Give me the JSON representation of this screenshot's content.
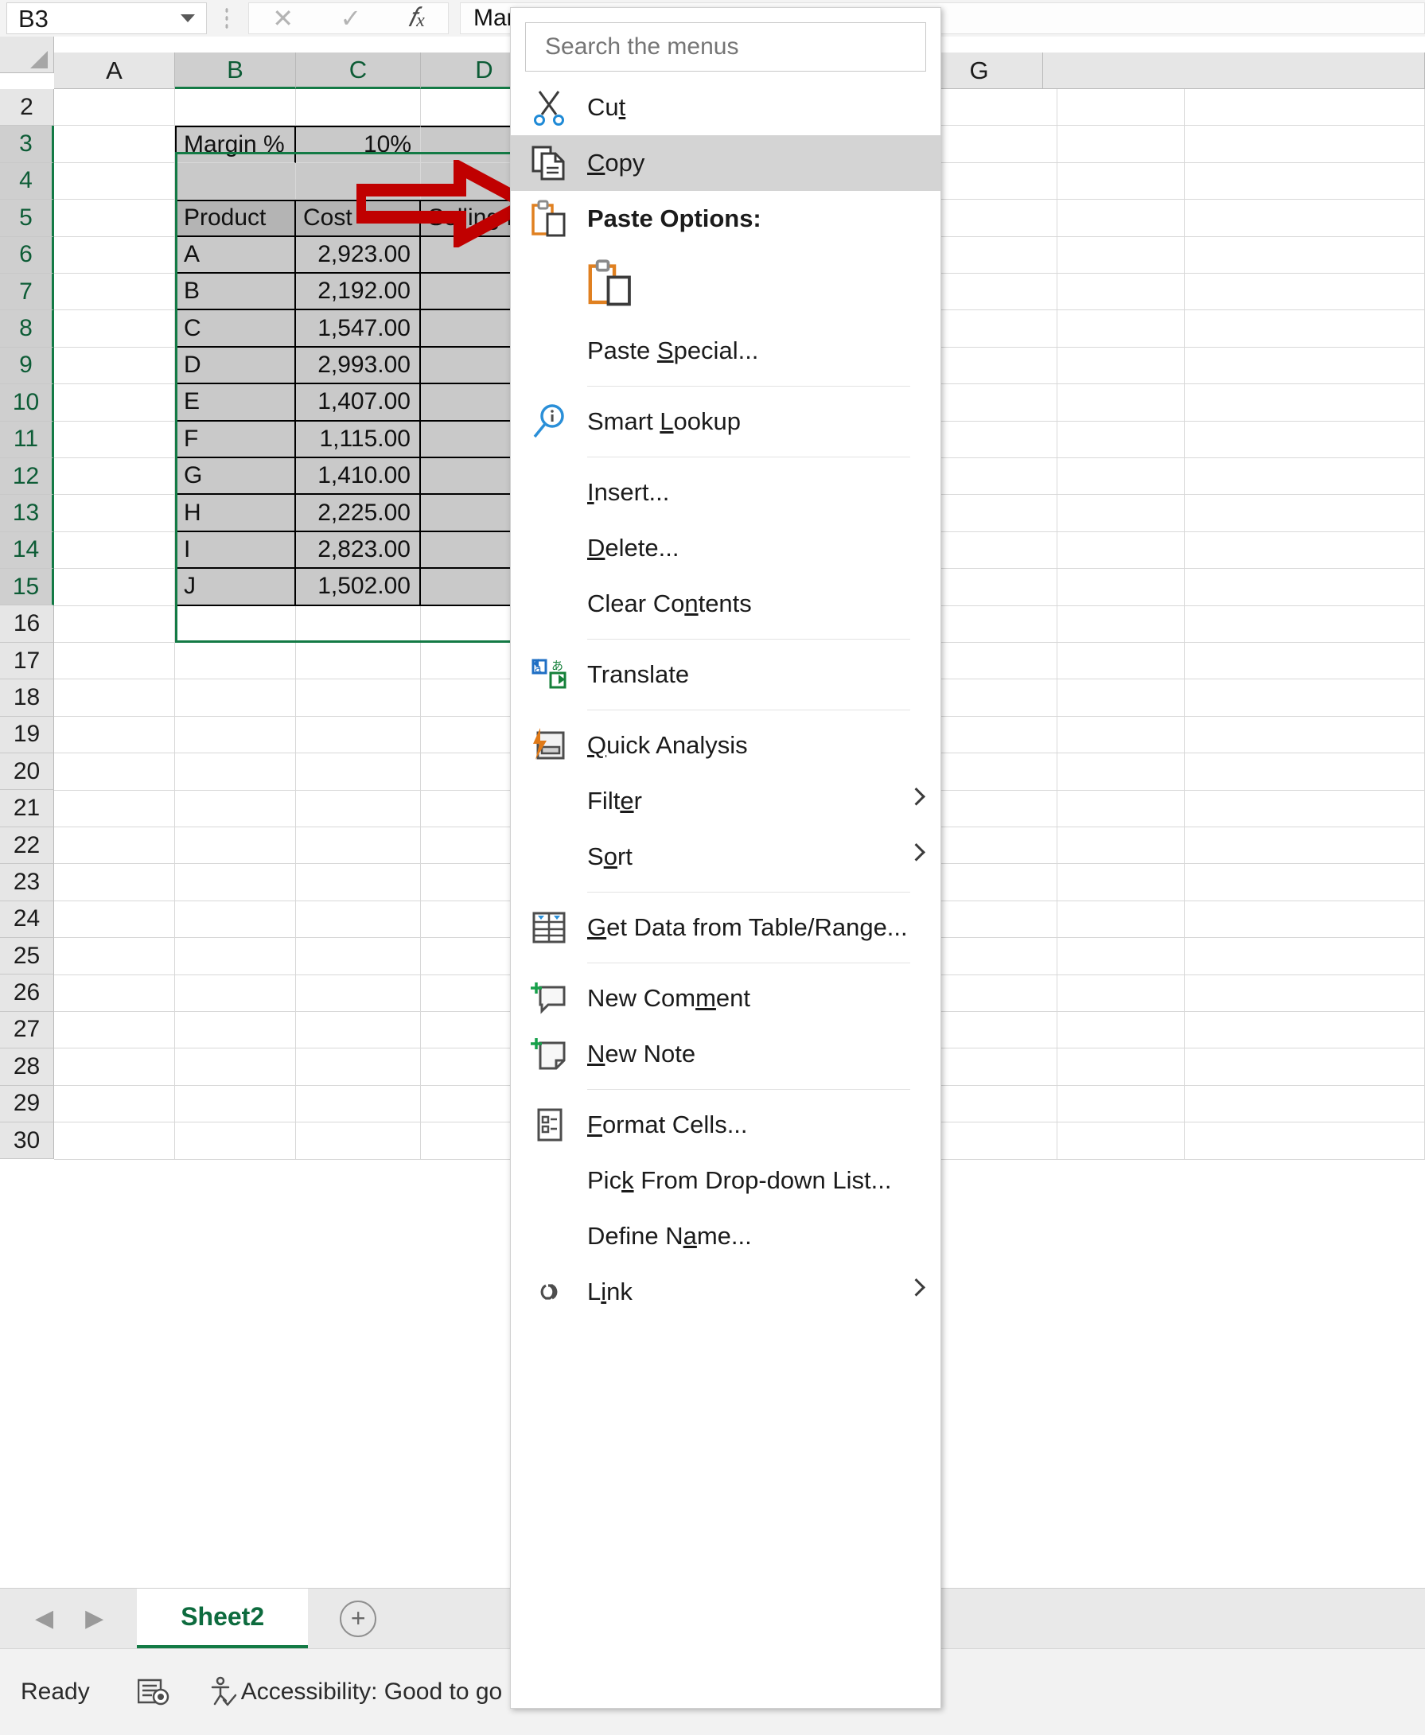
{
  "formula_bar": {
    "name_box_value": "B3",
    "formula_value": "Margin %",
    "cancel_icon": "cancel-x-icon",
    "confirm_icon": "confirm-check-icon",
    "function_icon": "insert-function-fx-icon"
  },
  "grid": {
    "column_headers": [
      "A",
      "B",
      "C",
      "D",
      "G"
    ],
    "row_headers": [
      "2",
      "3",
      "4",
      "5",
      "6",
      "7",
      "8",
      "9",
      "10",
      "11",
      "12",
      "13",
      "14",
      "15",
      "16",
      "17",
      "18",
      "19",
      "20",
      "21",
      "22",
      "23",
      "24",
      "25",
      "26",
      "27",
      "28",
      "29",
      "30"
    ],
    "margin_label": "Margin %",
    "margin_value": "10%",
    "table_headers": [
      "Product",
      "Cost",
      "Selling P"
    ],
    "rows": [
      {
        "product": "A",
        "cost": "2,923.00"
      },
      {
        "product": "B",
        "cost": "2,192.00"
      },
      {
        "product": "C",
        "cost": "1,547.00"
      },
      {
        "product": "D",
        "cost": "2,993.00"
      },
      {
        "product": "E",
        "cost": "1,407.00"
      },
      {
        "product": "F",
        "cost": "1,115.00"
      },
      {
        "product": "G",
        "cost": "1,410.00"
      },
      {
        "product": "H",
        "cost": "2,225.00"
      },
      {
        "product": "I",
        "cost": "2,823.00"
      },
      {
        "product": "J",
        "cost": "1,502.00"
      }
    ],
    "selection_color": "#137a45",
    "annotation_arrow_color": "#c00000"
  },
  "context_menu": {
    "search_placeholder": "Search the menus",
    "items": [
      {
        "label": "Cut",
        "accel_index": 2,
        "icon": "scissors-icon",
        "highlighted": false,
        "submenu": false,
        "bold": false
      },
      {
        "label": "Copy",
        "accel_index": 0,
        "icon": "copy-pages-icon",
        "highlighted": true,
        "submenu": false,
        "bold": false
      },
      {
        "label": "Paste Options:",
        "accel_index": -1,
        "icon": "clipboard-paste-icon",
        "highlighted": false,
        "submenu": false,
        "bold": true
      },
      {
        "label": "Paste Special...",
        "accel_index": 6,
        "icon": "none",
        "highlighted": false,
        "submenu": false,
        "bold": false
      },
      {
        "label": "Smart Lookup",
        "accel_index": 6,
        "icon": "magnifier-info-icon",
        "highlighted": false,
        "submenu": false,
        "bold": false
      },
      {
        "label": "Insert...",
        "accel_index": 0,
        "icon": "none",
        "highlighted": false,
        "submenu": false,
        "bold": false
      },
      {
        "label": "Delete...",
        "accel_index": 0,
        "icon": "none",
        "highlighted": false,
        "submenu": false,
        "bold": false
      },
      {
        "label": "Clear Contents",
        "accel_index": 8,
        "icon": "none",
        "highlighted": false,
        "submenu": false,
        "bold": false
      },
      {
        "label": "Translate",
        "accel_index": -1,
        "icon": "translate-icon",
        "highlighted": false,
        "submenu": false,
        "bold": false
      },
      {
        "label": "Quick Analysis",
        "accel_index": 0,
        "icon": "quick-analysis-icon",
        "highlighted": false,
        "submenu": false,
        "bold": false
      },
      {
        "label": "Filter",
        "accel_index": 4,
        "icon": "none",
        "highlighted": false,
        "submenu": true,
        "bold": false
      },
      {
        "label": "Sort",
        "accel_index": 1,
        "icon": "none",
        "highlighted": false,
        "submenu": true,
        "bold": false
      },
      {
        "label": "Get Data from Table/Range...",
        "accel_index": 0,
        "icon": "table-grid-icon",
        "highlighted": false,
        "submenu": false,
        "bold": false
      },
      {
        "label": "New Comment",
        "accel_index": 7,
        "icon": "new-comment-icon",
        "highlighted": false,
        "submenu": false,
        "bold": false
      },
      {
        "label": "New Note",
        "accel_index": 0,
        "icon": "new-note-icon",
        "highlighted": false,
        "submenu": false,
        "bold": false
      },
      {
        "label": "Format Cells...",
        "accel_index": 0,
        "icon": "format-cells-icon",
        "highlighted": false,
        "submenu": false,
        "bold": false
      },
      {
        "label": "Pick From Drop-down List...",
        "accel_index": 3,
        "icon": "none",
        "highlighted": false,
        "submenu": false,
        "bold": false
      },
      {
        "label": "Define Name...",
        "accel_index": 8,
        "icon": "none",
        "highlighted": false,
        "submenu": false,
        "bold": false
      },
      {
        "label": "Link",
        "accel_index": 1,
        "icon": "link-chain-icon",
        "highlighted": false,
        "submenu": true,
        "bold": false
      }
    ],
    "paste_option_icon": "clipboard-paste-large-icon",
    "highlight_color": "#d4d4d4"
  },
  "sheet_tabs": {
    "prev_icon": "prev-sheet-arrow-icon",
    "next_icon": "next-sheet-arrow-icon",
    "active_tab": "Sheet2",
    "add_sheet_icon": "add-sheet-plus-icon"
  },
  "status_bar": {
    "status_text": "Ready",
    "record_macro_icon": "record-macro-icon",
    "accessibility_icon": "accessibility-icon",
    "accessibility_text": "Accessibility: Good to go"
  }
}
